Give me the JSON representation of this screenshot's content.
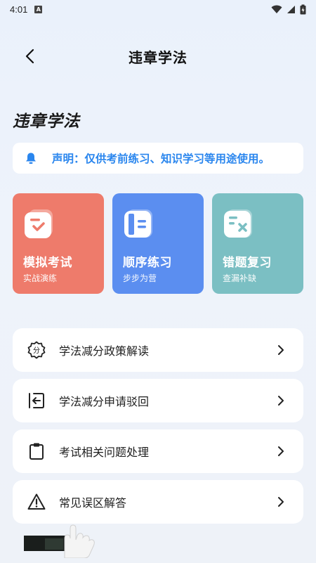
{
  "status_bar": {
    "time": "4:01",
    "notification_icon": "A"
  },
  "nav": {
    "back_icon": "back-arrow-icon",
    "title": "违章学法"
  },
  "page_heading": "违章学法",
  "notice": {
    "icon": "bell-icon",
    "text": "声明：仅供考前练习、知识学习等用途使用。",
    "color": "#2a86ee"
  },
  "cards": [
    {
      "title": "模拟考试",
      "subtitle": "实战演练",
      "icon": "exam-icon",
      "color": "#ee7b6b"
    },
    {
      "title": "顺序练习",
      "subtitle": "步步为营",
      "icon": "book-icon",
      "color": "#5b8ef0"
    },
    {
      "title": "错题复习",
      "subtitle": "查漏补缺",
      "icon": "wrong-list-icon",
      "color": "#7bbfc3"
    }
  ],
  "list": [
    {
      "label": "学法减分政策解读",
      "icon": "points-badge-icon"
    },
    {
      "label": "学法减分申请驳回",
      "icon": "return-icon"
    },
    {
      "label": "考试相关问题处理",
      "icon": "clipboard-icon"
    },
    {
      "label": "常见误区解答",
      "icon": "warning-icon"
    }
  ]
}
